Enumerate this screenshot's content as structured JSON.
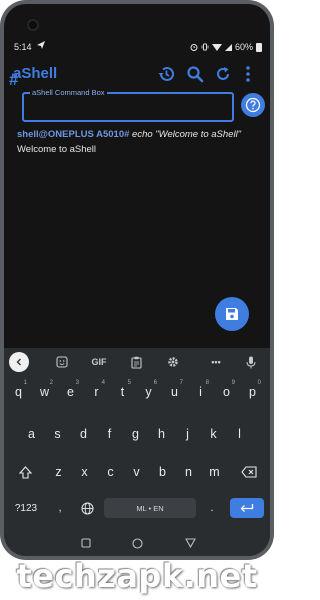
{
  "status_bar": {
    "time": "5:14",
    "send_icon": "send-icon",
    "battery": "60%"
  },
  "app_bar": {
    "title": "aShell",
    "actions": [
      "history-icon",
      "search-icon",
      "refresh-icon",
      "more-vert-icon"
    ]
  },
  "command_box": {
    "hash_symbol": "#",
    "label": "aShell Command Box",
    "value": ""
  },
  "output": {
    "prompt": "shell@ONEPLUS A5010#",
    "command": " echo \"Welcome to aShell\"",
    "result": "Welcome to aShell"
  },
  "keyboard": {
    "toolbar": [
      "sticker-icon",
      "GIF",
      "clipboard-icon",
      "gear-icon",
      "...",
      "mic-icon"
    ],
    "gif_label": "GIF",
    "more_label": "•••",
    "row1": [
      {
        "k": "q",
        "h": "1"
      },
      {
        "k": "w",
        "h": "2"
      },
      {
        "k": "e",
        "h": "3"
      },
      {
        "k": "r",
        "h": "4"
      },
      {
        "k": "t",
        "h": "5"
      },
      {
        "k": "y",
        "h": "6"
      },
      {
        "k": "u",
        "h": "7"
      },
      {
        "k": "i",
        "h": "8"
      },
      {
        "k": "o",
        "h": "9"
      },
      {
        "k": "p",
        "h": "0"
      }
    ],
    "row2": [
      "a",
      "s",
      "d",
      "f",
      "g",
      "h",
      "j",
      "k",
      "l"
    ],
    "row3": [
      "z",
      "x",
      "c",
      "v",
      "b",
      "n",
      "m"
    ],
    "symbols_label": "?123",
    "comma": ",",
    "period": ".",
    "space_label": "ML • EN"
  },
  "accent_color": "#3f7de0",
  "watermark": "techzapk.net"
}
